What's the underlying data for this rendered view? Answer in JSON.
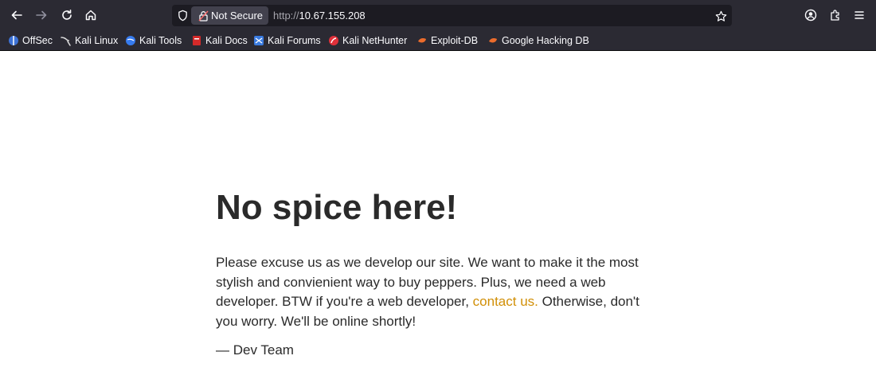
{
  "browser": {
    "security_label": "Not Secure",
    "url_scheme": "http://",
    "url_host": "10.67.155.208",
    "bookmarks": [
      {
        "label": "OffSec",
        "icon": "offsec-icon"
      },
      {
        "label": "Kali Linux",
        "icon": "kali-dragon-icon"
      },
      {
        "label": "Kali Tools",
        "icon": "kali-tools-icon"
      },
      {
        "label": "Kali Docs",
        "icon": "kali-docs-icon"
      },
      {
        "label": "Kali Forums",
        "icon": "kali-forums-icon"
      },
      {
        "label": "Kali NetHunter",
        "icon": "nethunter-icon"
      },
      {
        "label": "Exploit-DB",
        "icon": "exploit-db-icon"
      },
      {
        "label": "Google Hacking DB",
        "icon": "ghdb-icon"
      }
    ],
    "colors": {
      "chrome_bg": "#2b2a33",
      "urlbar_bg": "#1c1b22",
      "chip_bg": "#42414d",
      "text": "#fbfbfe"
    }
  },
  "page": {
    "heading": "No spice here!",
    "para_part1": "Please excuse us as we develop our site. We want to make it the most stylish and convienient way to buy peppers. Plus, we need a web developer. BTW if you're a web developer, ",
    "link_text": "contact us.",
    "para_part2": " Otherwise, don't you worry. We'll be online shortly!",
    "signature": "— Dev Team",
    "colors": {
      "text": "#2a2a2a",
      "link": "#d18f07"
    }
  }
}
